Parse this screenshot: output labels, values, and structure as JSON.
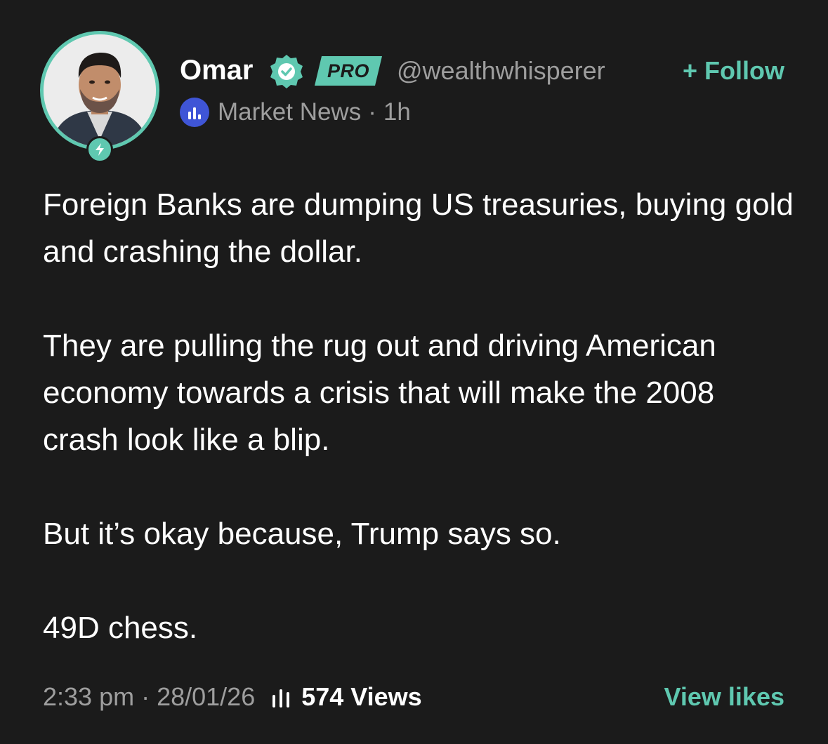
{
  "author": {
    "name": "Omar",
    "badge": "PRO",
    "handle": "@wealthwhisperer",
    "follow_label": "+ Follow"
  },
  "community": {
    "name": "Market News",
    "separator": "·",
    "time_ago": "1h"
  },
  "post": {
    "paragraphs": [
      "Foreign Banks are dumping US treasuries, buying gold and crashing the dollar.",
      "They are pulling the rug out and driving American economy towards a crisis that will make the 2008 crash look like a blip.",
      "But it’s okay because, Trump says so.",
      "49D chess."
    ]
  },
  "footer": {
    "time": "2:33 pm",
    "separator": "·",
    "date": "28/01/26",
    "views": "574 Views",
    "view_likes_label": "View likes"
  },
  "icons": {
    "avatar": "user-photo",
    "avatar_badge": "lightning-icon",
    "verified": "verified-badge-icon",
    "community": "bar-chart-icon",
    "views": "bar-chart-icon"
  },
  "colors": {
    "background": "#1b1b1b",
    "accent": "#5fc8b0",
    "secondary_text": "#9e9e9e",
    "community_icon": "#3f55d6"
  }
}
